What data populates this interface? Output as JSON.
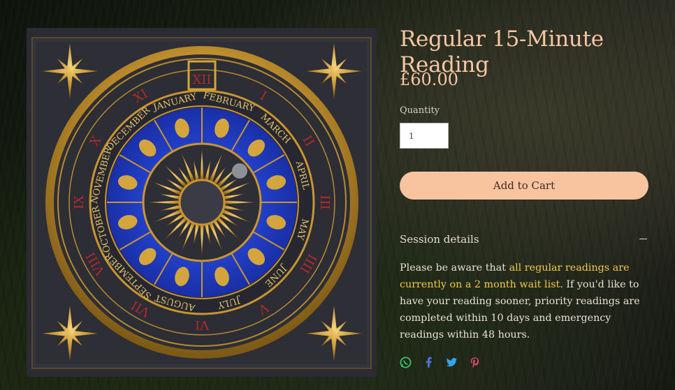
{
  "product": {
    "title": "Regular 15-Minute Reading",
    "price": "£60.00",
    "quantity_label": "Quantity",
    "quantity_value": "1",
    "add_to_cart_label": "Add to Cart"
  },
  "session": {
    "heading": "Session details",
    "text_before": "Please be aware that ",
    "text_highlight": "all regular readings are currently on a 2 month wait list",
    "text_after": ". If you'd like to have your reading sooner, priority readings are completed within 10 days and emergency readings within 48 hours."
  },
  "clock": {
    "months": [
      "NOVEMBER",
      "DECEMBER",
      "JANUARY",
      "FEBRUARY",
      "MARCH",
      "APRIL",
      "MAY",
      "JUNE",
      "JULY",
      "AUGUST",
      "SEPTEMBER",
      "OCTOBER"
    ]
  },
  "share_icons": [
    "whatsapp-icon",
    "facebook-icon",
    "twitter-icon",
    "pinterest-icon"
  ],
  "colors": {
    "title": "#f6c7a4",
    "button": "#f8c4a0",
    "highlight": "#f2c94c",
    "clock_blue": "#1f3fc4",
    "gold": "#d4a53c"
  }
}
